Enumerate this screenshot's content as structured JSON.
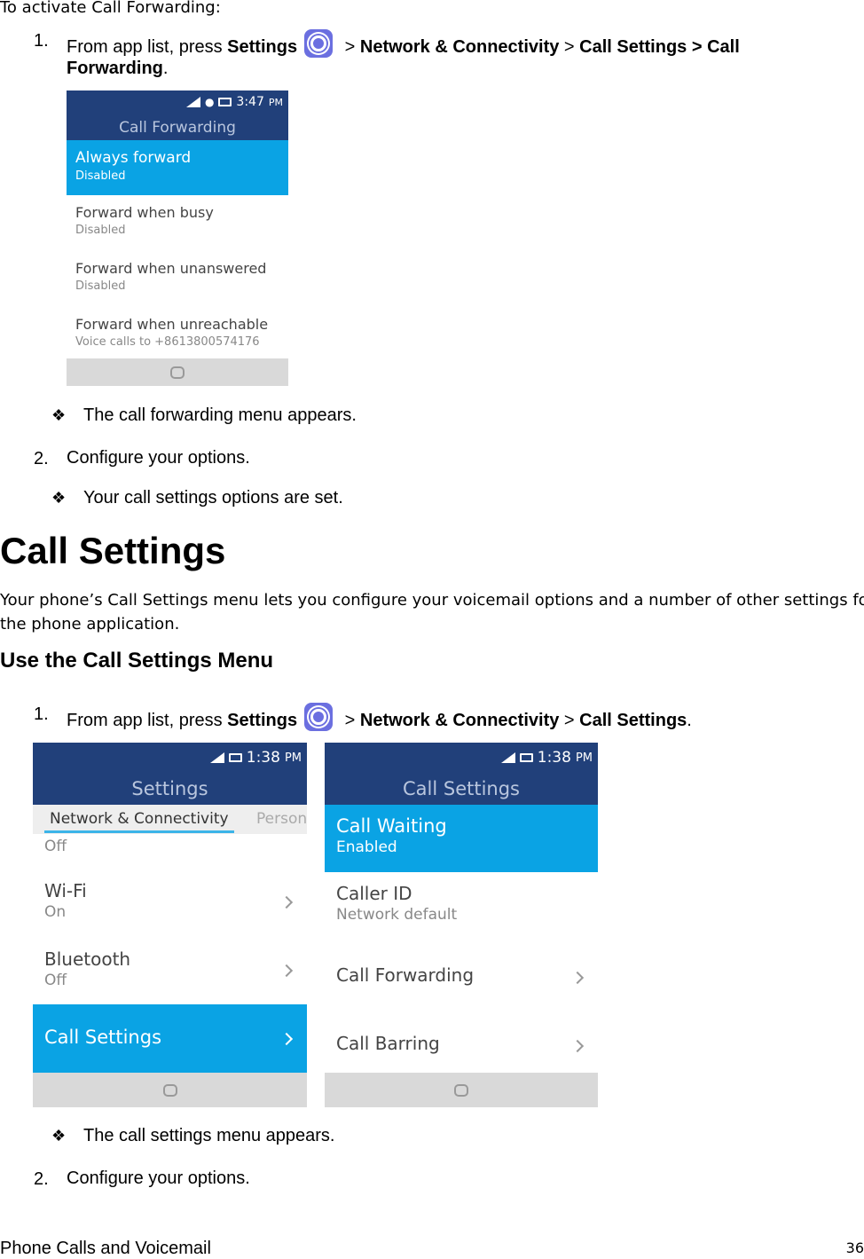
{
  "intro": "To activate Call Forwarding:",
  "step1a": {
    "num": "1.",
    "pre": "From app list, press ",
    "settings": "Settings",
    "sep1": " > ",
    "network": "Network & Connectivity",
    "sep2": " > ",
    "callsettings": "Call Settings > Call",
    "forwarding": "Forwarding",
    "end": "."
  },
  "phone1": {
    "time": "3:47",
    "ampm": "PM",
    "title": "Call Forwarding",
    "items": [
      {
        "label": "Always forward",
        "sub": "Disabled"
      },
      {
        "label": "Forward when busy",
        "sub": "Disabled"
      },
      {
        "label": "Forward when unanswered",
        "sub": "Disabled"
      },
      {
        "label": "Forward when unreachable",
        "sub": "Voice calls to +8613800574176"
      }
    ]
  },
  "bullet1": "The call forwarding menu appears.",
  "step2a": {
    "num": "2.",
    "text": "Configure your options."
  },
  "bullet2": "Your call settings options are set.",
  "heading": "Call Settings",
  "para": "Your phone’s Call Settings menu lets you configure your voicemail options and a number of other settings for",
  "para2": "the phone application.",
  "subheading": "Use the Call Settings Menu",
  "step1b": {
    "num": "1.",
    "pre": "From app list, press ",
    "settings": "Settings",
    "sep1": " > ",
    "network": "Network & Connectivity",
    "sep2": " > ",
    "callsettings": "Call Settings",
    "end": "."
  },
  "phone2": {
    "time": "1:38",
    "ampm": "PM",
    "title": "Settings",
    "tab_active": "Network & Connectivity",
    "tab_next": "Person",
    "items": [
      {
        "label": "",
        "sub": "Off"
      },
      {
        "label": "Wi-Fi",
        "sub": "On"
      },
      {
        "label": "Bluetooth",
        "sub": "Off"
      },
      {
        "label": "Call Settings",
        "sub": ""
      }
    ]
  },
  "phone3": {
    "time": "1:38",
    "ampm": "PM",
    "title": "Call Settings",
    "items": [
      {
        "label": "Call Waiting",
        "sub": "Enabled"
      },
      {
        "label": "Caller ID",
        "sub": "Network default"
      },
      {
        "label": "Call Forwarding",
        "sub": ""
      },
      {
        "label": "Call Barring",
        "sub": ""
      }
    ]
  },
  "bullet3": "The call settings menu appears.",
  "step2b": {
    "num": "2.",
    "text": "Configure your options."
  },
  "footer": {
    "section": "Phone Calls and Voicemail",
    "page": "36"
  },
  "colors": {
    "header": "#21407a",
    "highlight": "#0aa3e4",
    "settings_icon": "#6b6fe0"
  }
}
